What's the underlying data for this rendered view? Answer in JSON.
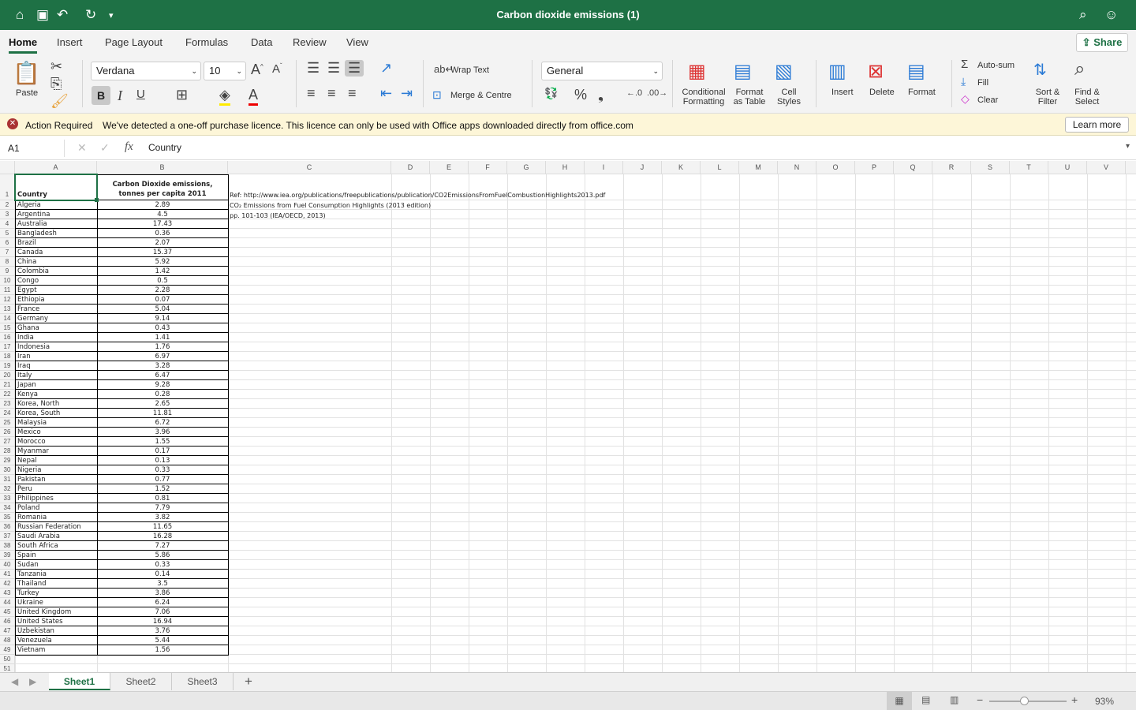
{
  "title": "Carbon dioxide emissions (1)",
  "tabs": [
    "Home",
    "Insert",
    "Page Layout",
    "Formulas",
    "Data",
    "Review",
    "View"
  ],
  "share_label": "Share",
  "ribbon": {
    "paste": "Paste",
    "font": "Verdana",
    "size": "10",
    "wrap": "Wrap Text",
    "merge": "Merge & Centre",
    "format": "General",
    "cond": [
      "Conditional",
      "Formatting"
    ],
    "fat": [
      "Format",
      "as Table"
    ],
    "cs": [
      "Cell",
      "Styles"
    ],
    "insert": "Insert",
    "delete": "Delete",
    "formatb": "Format",
    "autosum": "Auto-sum",
    "fill": "Fill",
    "clear": "Clear",
    "sort": [
      "Sort &",
      "Filter"
    ],
    "find": [
      "Find &",
      "Select"
    ]
  },
  "message": {
    "title": "Action Required",
    "text": "We've detected a one-off purchase licence. This licence can only be used with Office apps downloaded directly from office.com",
    "button": "Learn more"
  },
  "formula_bar": {
    "cell": "A1",
    "fx": "fx",
    "value": "Country"
  },
  "columns": [
    "A",
    "B",
    "C",
    "D",
    "E",
    "F",
    "G",
    "H",
    "I",
    "J",
    "K",
    "L",
    "M",
    "N",
    "O",
    "P",
    "Q",
    "R",
    "S",
    "T",
    "U",
    "V"
  ],
  "header": {
    "a": "Country",
    "b1": "Carbon Dioxide emissions,",
    "b2": "tonnes per capita 2011"
  },
  "notes": [
    "Ref:  http://www.iea.org/publications/freepublications/publication/CO2EmissionsFromFuelCombustionHighlights2013.pdf",
    "CO₂ Emissions from Fuel Consumption Highlights (2013 edition)",
    "pp. 101-103  (IEA/OECD, 2013)"
  ],
  "rows": [
    [
      "Algeria",
      "2.89"
    ],
    [
      "Argentina",
      "4.5"
    ],
    [
      "Australia",
      "17.43"
    ],
    [
      "Bangladesh",
      "0.36"
    ],
    [
      "Brazil",
      "2.07"
    ],
    [
      "Canada",
      "15.37"
    ],
    [
      "China",
      "5.92"
    ],
    [
      "Colombia",
      "1.42"
    ],
    [
      "Congo",
      "0.5"
    ],
    [
      "Egypt",
      "2.28"
    ],
    [
      "Ethiopia",
      "0.07"
    ],
    [
      "France",
      "5.04"
    ],
    [
      "Germany",
      "9.14"
    ],
    [
      "Ghana",
      "0.43"
    ],
    [
      "India",
      "1.41"
    ],
    [
      "Indonesia",
      "1.76"
    ],
    [
      "Iran",
      "6.97"
    ],
    [
      "Iraq",
      "3.28"
    ],
    [
      "Italy",
      "6.47"
    ],
    [
      "Japan",
      "9.28"
    ],
    [
      "Kenya",
      "0.28"
    ],
    [
      "Korea, North",
      "2.65"
    ],
    [
      "Korea, South",
      "11.81"
    ],
    [
      "Malaysia",
      "6.72"
    ],
    [
      "Mexico",
      "3.96"
    ],
    [
      "Morocco",
      "1.55"
    ],
    [
      "Myanmar",
      "0.17"
    ],
    [
      "Nepal",
      "0.13"
    ],
    [
      "Nigeria",
      "0.33"
    ],
    [
      "Pakistan",
      "0.77"
    ],
    [
      "Peru",
      "1.52"
    ],
    [
      "Philippines",
      "0.81"
    ],
    [
      "Poland",
      "7.79"
    ],
    [
      "Romania",
      "3.82"
    ],
    [
      "Russian Federation",
      "11.65"
    ],
    [
      "Saudi Arabia",
      "16.28"
    ],
    [
      "South Africa",
      "7.27"
    ],
    [
      "Spain",
      "5.86"
    ],
    [
      "Sudan",
      "0.33"
    ],
    [
      "Tanzania",
      "0.14"
    ],
    [
      "Thailand",
      "3.5"
    ],
    [
      "Turkey",
      "3.86"
    ],
    [
      "Ukraine",
      "6.24"
    ],
    [
      "United Kingdom",
      "7.06"
    ],
    [
      "United States",
      "16.94"
    ],
    [
      "Uzbekistan",
      "3.76"
    ],
    [
      "Venezuela",
      "5.44"
    ],
    [
      "Vietnam",
      "1.56"
    ]
  ],
  "sheets": [
    "Sheet1",
    "Sheet2",
    "Sheet3"
  ],
  "zoom": "93%",
  "accent": "#1e7145"
}
